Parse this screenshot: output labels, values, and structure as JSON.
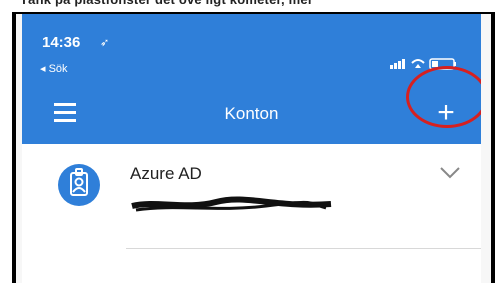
{
  "status": {
    "time": "14:36",
    "location_icon": "location-arrow-icon",
    "back_label": "◂ Sök",
    "icons": [
      "signal-icon",
      "wifi-icon",
      "battery-icon"
    ]
  },
  "nav": {
    "title": "Konton",
    "menu_icon": "hamburger-menu-icon",
    "add_label": "+"
  },
  "accounts": [
    {
      "name": "Azure AD",
      "icon": "id-badge-icon"
    }
  ],
  "colors": {
    "accent": "#2f7fd9",
    "annotation": "#d62020"
  }
}
